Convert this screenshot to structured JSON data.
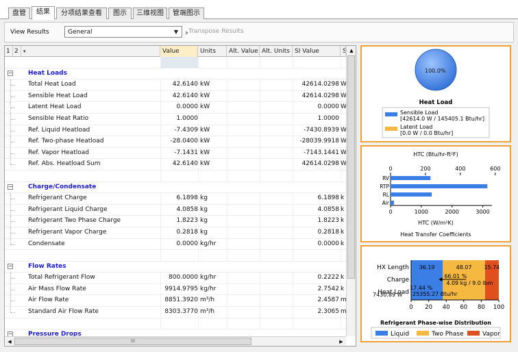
{
  "tabs": [
    {
      "label": "盘管",
      "active": false
    },
    {
      "label": "结果",
      "active": true
    },
    {
      "label": "分项结果查看",
      "active": false
    },
    {
      "label": "图示",
      "active": false
    },
    {
      "label": "三维视图",
      "active": false
    },
    {
      "label": "管端图示",
      "active": false
    }
  ],
  "toolbar": {
    "view_results_label": "View Results",
    "view_results_value": "General",
    "transpose_label": "Transpose Results"
  },
  "grid": {
    "level_buttons": [
      "1",
      "2"
    ],
    "columns": [
      "Value",
      "Units",
      "Alt. Value",
      "Alt. Units",
      "SI Value",
      "S"
    ],
    "sections": [
      {
        "title": "Heat Loads",
        "rows": [
          {
            "label": "Total Heat Load",
            "value": "42.6140",
            "units": "kW",
            "si_value": "42614.0298",
            "si_units": "W"
          },
          {
            "label": "Sensible Heat Load",
            "value": "42.6140",
            "units": "kW",
            "si_value": "42614.0298",
            "si_units": "W"
          },
          {
            "label": "Latent Heat Load",
            "value": "0.0000",
            "units": "kW",
            "si_value": "0.0000",
            "si_units": "W"
          },
          {
            "label": "Sensible Heat Ratio",
            "value": "1.0000",
            "units": "",
            "si_value": "1.0000",
            "si_units": ""
          },
          {
            "label": "Ref. Liquid Heatload",
            "value": "-7.4309",
            "units": "kW",
            "si_value": "-7430.8939",
            "si_units": "W"
          },
          {
            "label": "Ref. Two-phase Heatload",
            "value": "-28.0400",
            "units": "kW",
            "si_value": "-28039.9918",
            "si_units": "W"
          },
          {
            "label": "Ref. Vapor Heatload",
            "value": "-7.1431",
            "units": "kW",
            "si_value": "-7143.1441",
            "si_units": "W"
          },
          {
            "label": "Ref. Abs. Heatload Sum",
            "value": "42.6140",
            "units": "kW",
            "si_value": "42614.0298",
            "si_units": "W"
          }
        ]
      },
      {
        "title": "Charge/Condensate",
        "rows": [
          {
            "label": "Refrigerant Charge",
            "value": "6.1898",
            "units": "kg",
            "si_value": "6.1898",
            "si_units": "k"
          },
          {
            "label": "Refrigerant Liquid Charge",
            "value": "4.0858",
            "units": "kg",
            "si_value": "4.0858",
            "si_units": "k"
          },
          {
            "label": "Refrigerant Two Phase Charge",
            "value": "1.8223",
            "units": "kg",
            "si_value": "1.8223",
            "si_units": "k"
          },
          {
            "label": "Refrigerant Vapor Charge",
            "value": "0.2818",
            "units": "kg",
            "si_value": "0.2818",
            "si_units": "k"
          },
          {
            "label": "Condensate",
            "value": "0.0000",
            "units": "kg/hr",
            "si_value": "0.0000",
            "si_units": "k"
          }
        ]
      },
      {
        "title": "Flow Rates",
        "rows": [
          {
            "label": "Total Refrigerant Flow",
            "value": "800.0000",
            "units": "kg/hr",
            "si_value": "0.2222",
            "si_units": "k"
          },
          {
            "label": "Air Mass Flow Rate",
            "value": "9914.9795",
            "units": "kg/hr",
            "si_value": "2.7542",
            "si_units": "k"
          },
          {
            "label": "Air Flow Rate",
            "value": "8851.3920",
            "units": "m³/h",
            "si_value": "2.4587",
            "si_units": "m"
          },
          {
            "label": "Standard Air Flow Rate",
            "value": "8303.3770",
            "units": "m³/h",
            "si_value": "2.3065",
            "si_units": "m"
          }
        ]
      }
    ],
    "partial_section_title": "Pressure Drops",
    "hscroll_grip": "III"
  },
  "chart_data": [
    {
      "type": "pie",
      "title": "Heat Load",
      "slices": [
        {
          "name": "Sensible Load",
          "value": 100.0,
          "label": "100.0%",
          "detail": "[42614.0 W / 145405.1 Btu/hr]",
          "color": "#3a7ee6"
        },
        {
          "name": "Latent Load",
          "value": 0.0,
          "label": "",
          "detail": "[0.0 W / 0.0 Btu/hr]",
          "color": "#f5b941"
        }
      ]
    },
    {
      "type": "bar",
      "orientation": "horizontal",
      "title": "Heat Transfer Coefficients",
      "xlabel_top": "HTC (Btu/hr-ft²F)",
      "xlabel_bottom": "HTC (W/m²K)",
      "categories": [
        "RV",
        "RTP",
        "RL",
        "Air"
      ],
      "values_si": [
        1300,
        3150,
        1340,
        110
      ],
      "si_axis": {
        "ticks": [
          "0",
          "1000",
          "2000",
          "3000"
        ],
        "range": [
          0,
          3300
        ]
      },
      "ip_axis": {
        "ticks": [
          "0",
          "200",
          "400",
          "600"
        ],
        "range": [
          0,
          581.2
        ]
      },
      "bar_color": "#3a7ee6"
    },
    {
      "type": "bar",
      "orientation": "horizontal",
      "stacked": true,
      "title": "Refrigerant Phase-wise Distribution",
      "categories": [
        "HX Length",
        "Charge",
        "Heat Load"
      ],
      "x_ticks": [
        "0",
        "20",
        "40",
        "60",
        "80",
        "100"
      ],
      "xlim": [
        0,
        100
      ],
      "series": [
        {
          "name": "Liquid",
          "color": "#3a7ee6"
        },
        {
          "name": "Two Phase",
          "color": "#f5b941"
        },
        {
          "name": "Vapor",
          "color": "#e0501e"
        }
      ],
      "hx_length": {
        "liquid": 36.19,
        "two_phase": 48.07,
        "vapor": 15.74
      },
      "labels": {
        "hx_liquid": "36.19",
        "hx_two_phase": "48.07",
        "hx_vapor": "15.74",
        "charge_two_phase": "66.01 %",
        "charge_detail": "4.09 kg / 9.0 lbm",
        "heat_liquid_pct": "17.44 %",
        "heat_liquid_val": "7430.89 W",
        "heat_two_phase": "25355.27 Btu/hr"
      }
    }
  ]
}
